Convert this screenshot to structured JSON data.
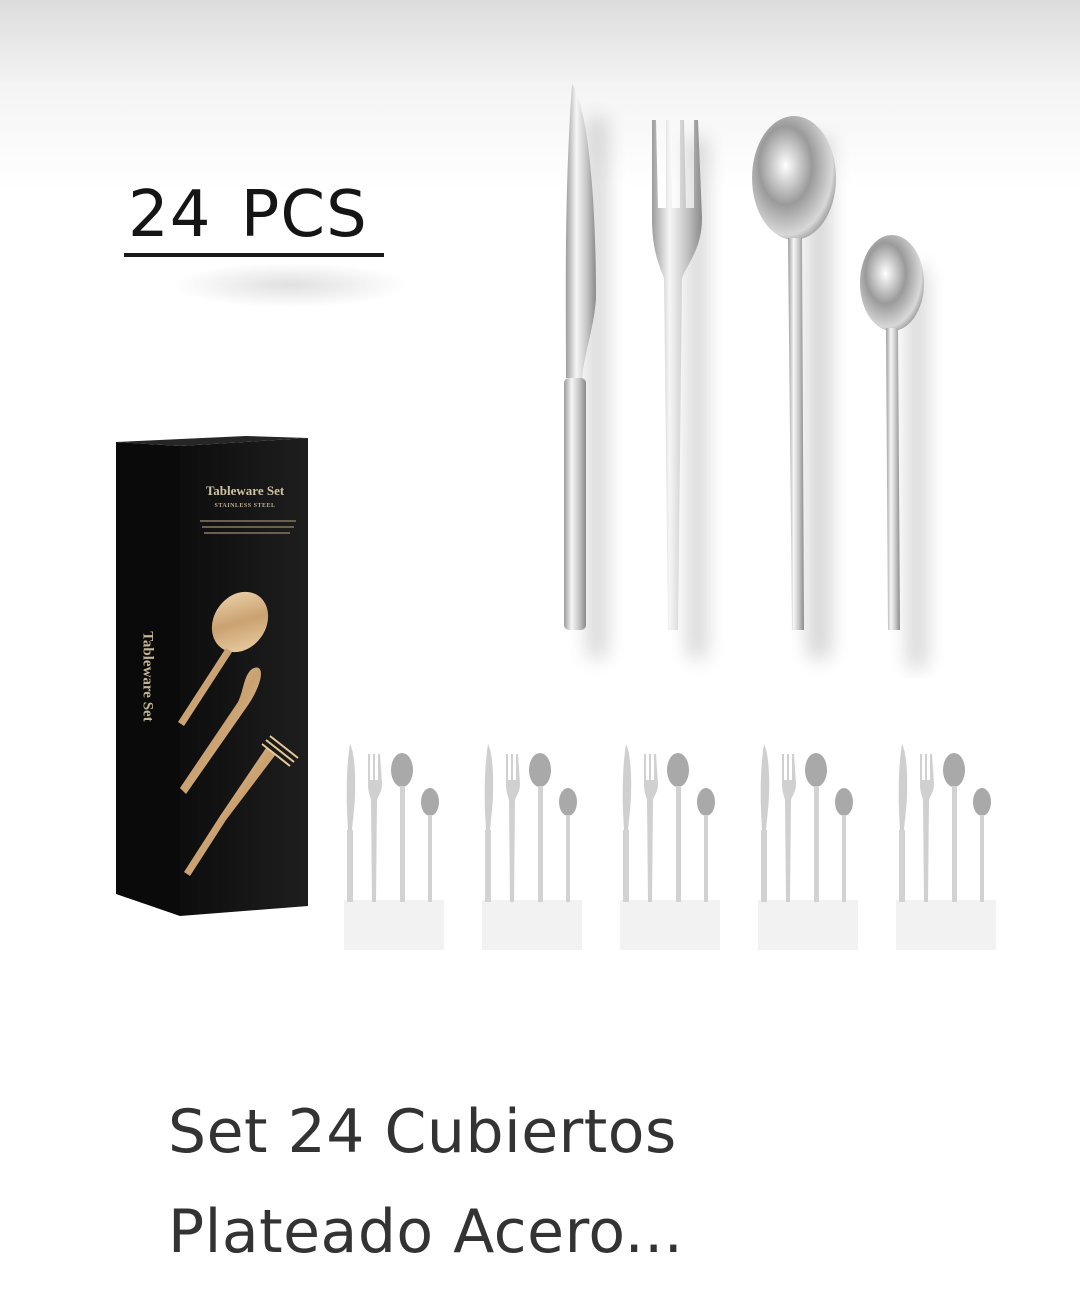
{
  "product_image": {
    "pcs_label": "24 PCS",
    "box": {
      "title": "Tableware Set",
      "subtitle": "STAINLESS STEEL",
      "side_text": "Tableware Set"
    },
    "mini_sets_count": 5
  },
  "product": {
    "title_line1": "Set 24 Cubiertos",
    "title_line2": "Plateado Acero..."
  },
  "colors": {
    "box": "#141414",
    "gold": "#d8b98d",
    "silver": "#d9d9d9",
    "title_text": "#333333"
  }
}
